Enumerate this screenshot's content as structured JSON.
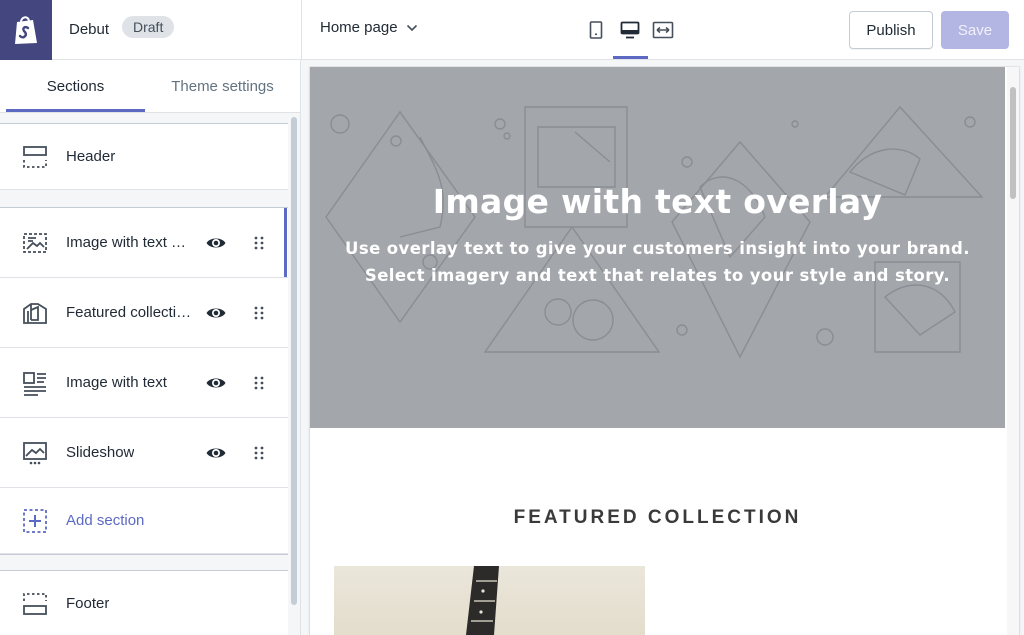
{
  "topbar": {
    "theme_name": "Debut",
    "status_badge": "Draft",
    "page_selector": "Home page",
    "view_modes": [
      {
        "name": "mobile",
        "icon": "mobile-icon"
      },
      {
        "name": "desktop",
        "icon": "desktop-icon",
        "active": true
      },
      {
        "name": "full-width",
        "icon": "fullscreen-icon"
      }
    ],
    "publish_label": "Publish",
    "save_label": "Save"
  },
  "sidebar": {
    "tabs": [
      {
        "label": "Sections",
        "active": true
      },
      {
        "label": "Theme settings",
        "active": false
      }
    ],
    "header_item": {
      "label": "Header",
      "icon": "header-icon"
    },
    "sections": [
      {
        "label": "Image with text overlay",
        "icon": "image-overlay-icon",
        "active": true
      },
      {
        "label": "Featured collection",
        "icon": "collection-icon",
        "active": false
      },
      {
        "label": "Image with text",
        "icon": "text-image-icon",
        "active": false
      },
      {
        "label": "Slideshow",
        "icon": "slideshow-icon",
        "active": false
      }
    ],
    "add_section_label": "Add section",
    "footer_item": {
      "label": "Footer",
      "icon": "footer-icon"
    }
  },
  "preview": {
    "hero_title": "Image with text overlay",
    "hero_subtitle": "Use overlay text to give your customers insight into your brand. Select imagery and text that relates to your style and story.",
    "featured_title": "FEATURED COLLECTION"
  },
  "colors": {
    "accent": "#5c6ac4",
    "logo_bg": "#43467f",
    "save_disabled": "#b3b5e3",
    "hero_bg": "#a3a6ab"
  }
}
